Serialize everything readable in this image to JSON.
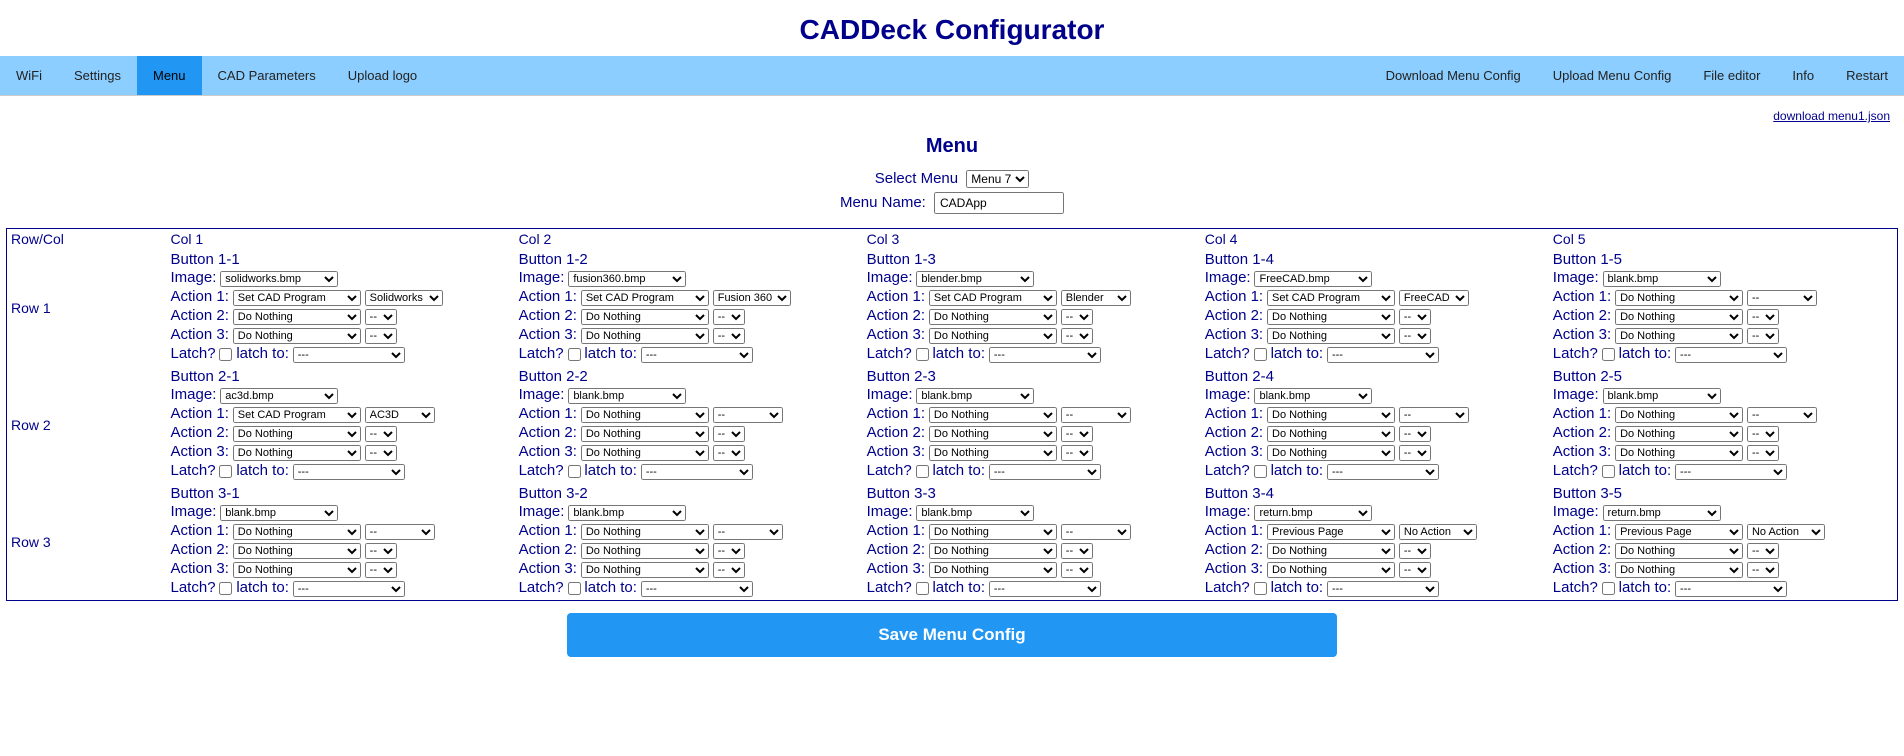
{
  "title": "CADDeck Configurator",
  "nav_left": [
    "WiFi",
    "Settings",
    "Menu",
    "CAD Parameters",
    "Upload logo"
  ],
  "nav_right": [
    "Download Menu Config",
    "Upload Menu Config",
    "File editor",
    "Info",
    "Restart"
  ],
  "nav_active_index": 2,
  "download_link": "download menu1.json",
  "section_title": "Menu",
  "select_menu_label": "Select Menu",
  "select_menu_value": "Menu 7",
  "menu_name_label": "Menu Name:",
  "menu_name_value": "CADApp",
  "row_col_header": "Row/Col",
  "col_headers": [
    "Col 1",
    "Col 2",
    "Col 3",
    "Col 4",
    "Col 5"
  ],
  "row_labels": [
    "Row 1",
    "Row 2",
    "Row 3"
  ],
  "labels": {
    "image": "Image:",
    "action1": "Action 1:",
    "action2": "Action 2:",
    "action3": "Action 3:",
    "latch": "Latch?",
    "latch_to": "latch to:",
    "dash": "--",
    "dashes": "---"
  },
  "save_button": "Save Menu Config",
  "buttons": [
    [
      {
        "title": "Button 1-1",
        "image": "solidworks.bmp",
        "a1": "Set CAD Program",
        "p1": "Solidworks",
        "a2": "Do Nothing",
        "p2": "--",
        "a3": "Do Nothing",
        "p3": "--",
        "latch": "---"
      },
      {
        "title": "Button 1-2",
        "image": "fusion360.bmp",
        "a1": "Set CAD Program",
        "p1": "Fusion 360",
        "a2": "Do Nothing",
        "p2": "--",
        "a3": "Do Nothing",
        "p3": "--",
        "latch": "---"
      },
      {
        "title": "Button 1-3",
        "image": "blender.bmp",
        "a1": "Set CAD Program",
        "p1": "Blender",
        "a2": "Do Nothing",
        "p2": "--",
        "a3": "Do Nothing",
        "p3": "--",
        "latch": "---"
      },
      {
        "title": "Button 1-4",
        "image": "FreeCAD.bmp",
        "a1": "Set CAD Program",
        "p1": "FreeCAD",
        "a2": "Do Nothing",
        "p2": "--",
        "a3": "Do Nothing",
        "p3": "--",
        "latch": "---"
      },
      {
        "title": "Button 1-5",
        "image": "blank.bmp",
        "a1": "Do Nothing",
        "p1": "--",
        "a2": "Do Nothing",
        "p2": "--",
        "a3": "Do Nothing",
        "p3": "--",
        "latch": "---"
      }
    ],
    [
      {
        "title": "Button 2-1",
        "image": "ac3d.bmp",
        "a1": "Set CAD Program",
        "p1": "AC3D",
        "a2": "Do Nothing",
        "p2": "--",
        "a3": "Do Nothing",
        "p3": "--",
        "latch": "---"
      },
      {
        "title": "Button 2-2",
        "image": "blank.bmp",
        "a1": "Do Nothing",
        "p1": "--",
        "a2": "Do Nothing",
        "p2": "--",
        "a3": "Do Nothing",
        "p3": "--",
        "latch": "---"
      },
      {
        "title": "Button 2-3",
        "image": "blank.bmp",
        "a1": "Do Nothing",
        "p1": "--",
        "a2": "Do Nothing",
        "p2": "--",
        "a3": "Do Nothing",
        "p3": "--",
        "latch": "---"
      },
      {
        "title": "Button 2-4",
        "image": "blank.bmp",
        "a1": "Do Nothing",
        "p1": "--",
        "a2": "Do Nothing",
        "p2": "--",
        "a3": "Do Nothing",
        "p3": "--",
        "latch": "---"
      },
      {
        "title": "Button 2-5",
        "image": "blank.bmp",
        "a1": "Do Nothing",
        "p1": "--",
        "a2": "Do Nothing",
        "p2": "--",
        "a3": "Do Nothing",
        "p3": "--",
        "latch": "---"
      }
    ],
    [
      {
        "title": "Button 3-1",
        "image": "blank.bmp",
        "a1": "Do Nothing",
        "p1": "--",
        "a2": "Do Nothing",
        "p2": "--",
        "a3": "Do Nothing",
        "p3": "--",
        "latch": "---"
      },
      {
        "title": "Button 3-2",
        "image": "blank.bmp",
        "a1": "Do Nothing",
        "p1": "--",
        "a2": "Do Nothing",
        "p2": "--",
        "a3": "Do Nothing",
        "p3": "--",
        "latch": "---"
      },
      {
        "title": "Button 3-3",
        "image": "blank.bmp",
        "a1": "Do Nothing",
        "p1": "--",
        "a2": "Do Nothing",
        "p2": "--",
        "a3": "Do Nothing",
        "p3": "--",
        "latch": "---"
      },
      {
        "title": "Button 3-4",
        "image": "return.bmp",
        "a1": "Previous Page",
        "p1": "No Action",
        "a2": "Do Nothing",
        "p2": "--",
        "a3": "Do Nothing",
        "p3": "--",
        "latch": "---"
      },
      {
        "title": "Button 3-5",
        "image": "return.bmp",
        "a1": "Previous Page",
        "p1": "No Action",
        "a2": "Do Nothing",
        "p2": "--",
        "a3": "Do Nothing",
        "p3": "--",
        "latch": "---"
      }
    ]
  ]
}
